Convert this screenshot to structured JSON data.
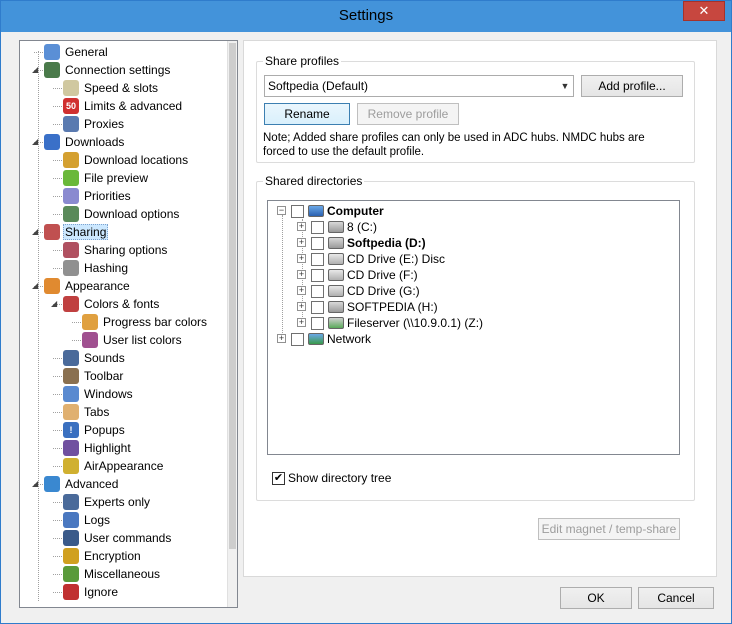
{
  "window": {
    "title": "Settings",
    "close_label": "✕"
  },
  "tree": [
    {
      "label": "General",
      "level": 1,
      "icon_color": "#5a8fd6",
      "glyph": ""
    },
    {
      "label": "Connection settings",
      "level": 1,
      "expander": "◢",
      "icon_color": "#4a7a4a",
      "glyph": ""
    },
    {
      "label": "Speed & slots",
      "level": 2,
      "icon_color": "#d0c8a0",
      "glyph": ""
    },
    {
      "label": "Limits & advanced",
      "level": 2,
      "icon_color": "#d03030",
      "glyph": "50"
    },
    {
      "label": "Proxies",
      "level": 2,
      "icon_color": "#5a7ab0",
      "glyph": ""
    },
    {
      "label": "Downloads",
      "level": 1,
      "expander": "◢",
      "icon_color": "#3a70c8",
      "glyph": ""
    },
    {
      "label": "Download locations",
      "level": 2,
      "icon_color": "#d4a030",
      "glyph": ""
    },
    {
      "label": "File preview",
      "level": 2,
      "icon_color": "#6ab83a",
      "glyph": ""
    },
    {
      "label": "Priorities",
      "level": 2,
      "icon_color": "#8a8ad0",
      "glyph": ""
    },
    {
      "label": "Download options",
      "level": 2,
      "icon_color": "#5a8a5a",
      "glyph": ""
    },
    {
      "label": "Sharing",
      "level": 1,
      "expander": "◢",
      "icon_color": "#c05050",
      "glyph": "",
      "selected": true
    },
    {
      "label": "Sharing options",
      "level": 2,
      "icon_color": "#b05060",
      "glyph": ""
    },
    {
      "label": "Hashing",
      "level": 2,
      "icon_color": "#909090",
      "glyph": ""
    },
    {
      "label": "Appearance",
      "level": 1,
      "expander": "◢",
      "icon_color": "#e08a30",
      "glyph": ""
    },
    {
      "label": "Colors & fonts",
      "level": 2,
      "expander": "◢",
      "icon_color": "#c04040",
      "glyph": ""
    },
    {
      "label": "Progress bar colors",
      "level": 3,
      "icon_color": "#e0a040",
      "glyph": ""
    },
    {
      "label": "User list colors",
      "level": 3,
      "icon_color": "#a05090",
      "glyph": ""
    },
    {
      "label": "Sounds",
      "level": 2,
      "icon_color": "#4a6a9a",
      "glyph": ""
    },
    {
      "label": "Toolbar",
      "level": 2,
      "icon_color": "#8a7050",
      "glyph": ""
    },
    {
      "label": "Windows",
      "level": 2,
      "icon_color": "#5a8ad0",
      "glyph": ""
    },
    {
      "label": "Tabs",
      "level": 2,
      "icon_color": "#e0b070",
      "glyph": ""
    },
    {
      "label": "Popups",
      "level": 2,
      "icon_color": "#3a70c0",
      "glyph": "!"
    },
    {
      "label": "Highlight",
      "level": 2,
      "icon_color": "#7050a0",
      "glyph": ""
    },
    {
      "label": "AirAppearance",
      "level": 2,
      "icon_color": "#d0b030",
      "glyph": ""
    },
    {
      "label": "Advanced",
      "level": 1,
      "expander": "◢",
      "icon_color": "#3a88d0",
      "glyph": ""
    },
    {
      "label": "Experts only",
      "level": 2,
      "icon_color": "#4a6a9a",
      "glyph": ""
    },
    {
      "label": "Logs",
      "level": 2,
      "icon_color": "#4a78c0",
      "glyph": ""
    },
    {
      "label": "User commands",
      "level": 2,
      "icon_color": "#3a5a8a",
      "glyph": ""
    },
    {
      "label": "Encryption",
      "level": 2,
      "icon_color": "#d0a020",
      "glyph": ""
    },
    {
      "label": "Miscellaneous",
      "level": 2,
      "icon_color": "#5a9a3a",
      "glyph": ""
    },
    {
      "label": "Ignore",
      "level": 2,
      "icon_color": "#c03030",
      "glyph": ""
    }
  ],
  "share_profiles": {
    "title": "Share profiles",
    "selected": "Softpedia (Default)",
    "add_label": "Add profile...",
    "rename_label": "Rename",
    "remove_label": "Remove profile",
    "note_line1": "Note; Added share profiles can only be used in ADC hubs. NMDC hubs are",
    "note_line2": "forced to use the default profile."
  },
  "shared_dirs": {
    "title": "Shared directories",
    "items": [
      {
        "label": "Computer",
        "level": 0,
        "bold": true,
        "kind": "computer"
      },
      {
        "label": "8 (C:)",
        "level": 1,
        "bold": false,
        "kind": "drive"
      },
      {
        "label": "Softpedia (D:)",
        "level": 1,
        "bold": true,
        "kind": "drive"
      },
      {
        "label": "CD Drive (E:) Disc",
        "level": 1,
        "bold": false,
        "kind": "cd"
      },
      {
        "label": "CD Drive (F:)",
        "level": 1,
        "bold": false,
        "kind": "cd"
      },
      {
        "label": "CD Drive (G:)",
        "level": 1,
        "bold": false,
        "kind": "cd"
      },
      {
        "label": "SOFTPEDIA (H:)",
        "level": 1,
        "bold": false,
        "kind": "drive"
      },
      {
        "label": "Fileserver (\\\\10.9.0.1) (Z:)",
        "level": 1,
        "bold": false,
        "kind": "net"
      },
      {
        "label": "Network",
        "level": 0,
        "bold": false,
        "kind": "network"
      }
    ],
    "show_tree_label": "Show directory tree",
    "show_tree_checked": "✔"
  },
  "edit_magnet_label": "Edit magnet / temp-share",
  "ok_label": "OK",
  "cancel_label": "Cancel"
}
